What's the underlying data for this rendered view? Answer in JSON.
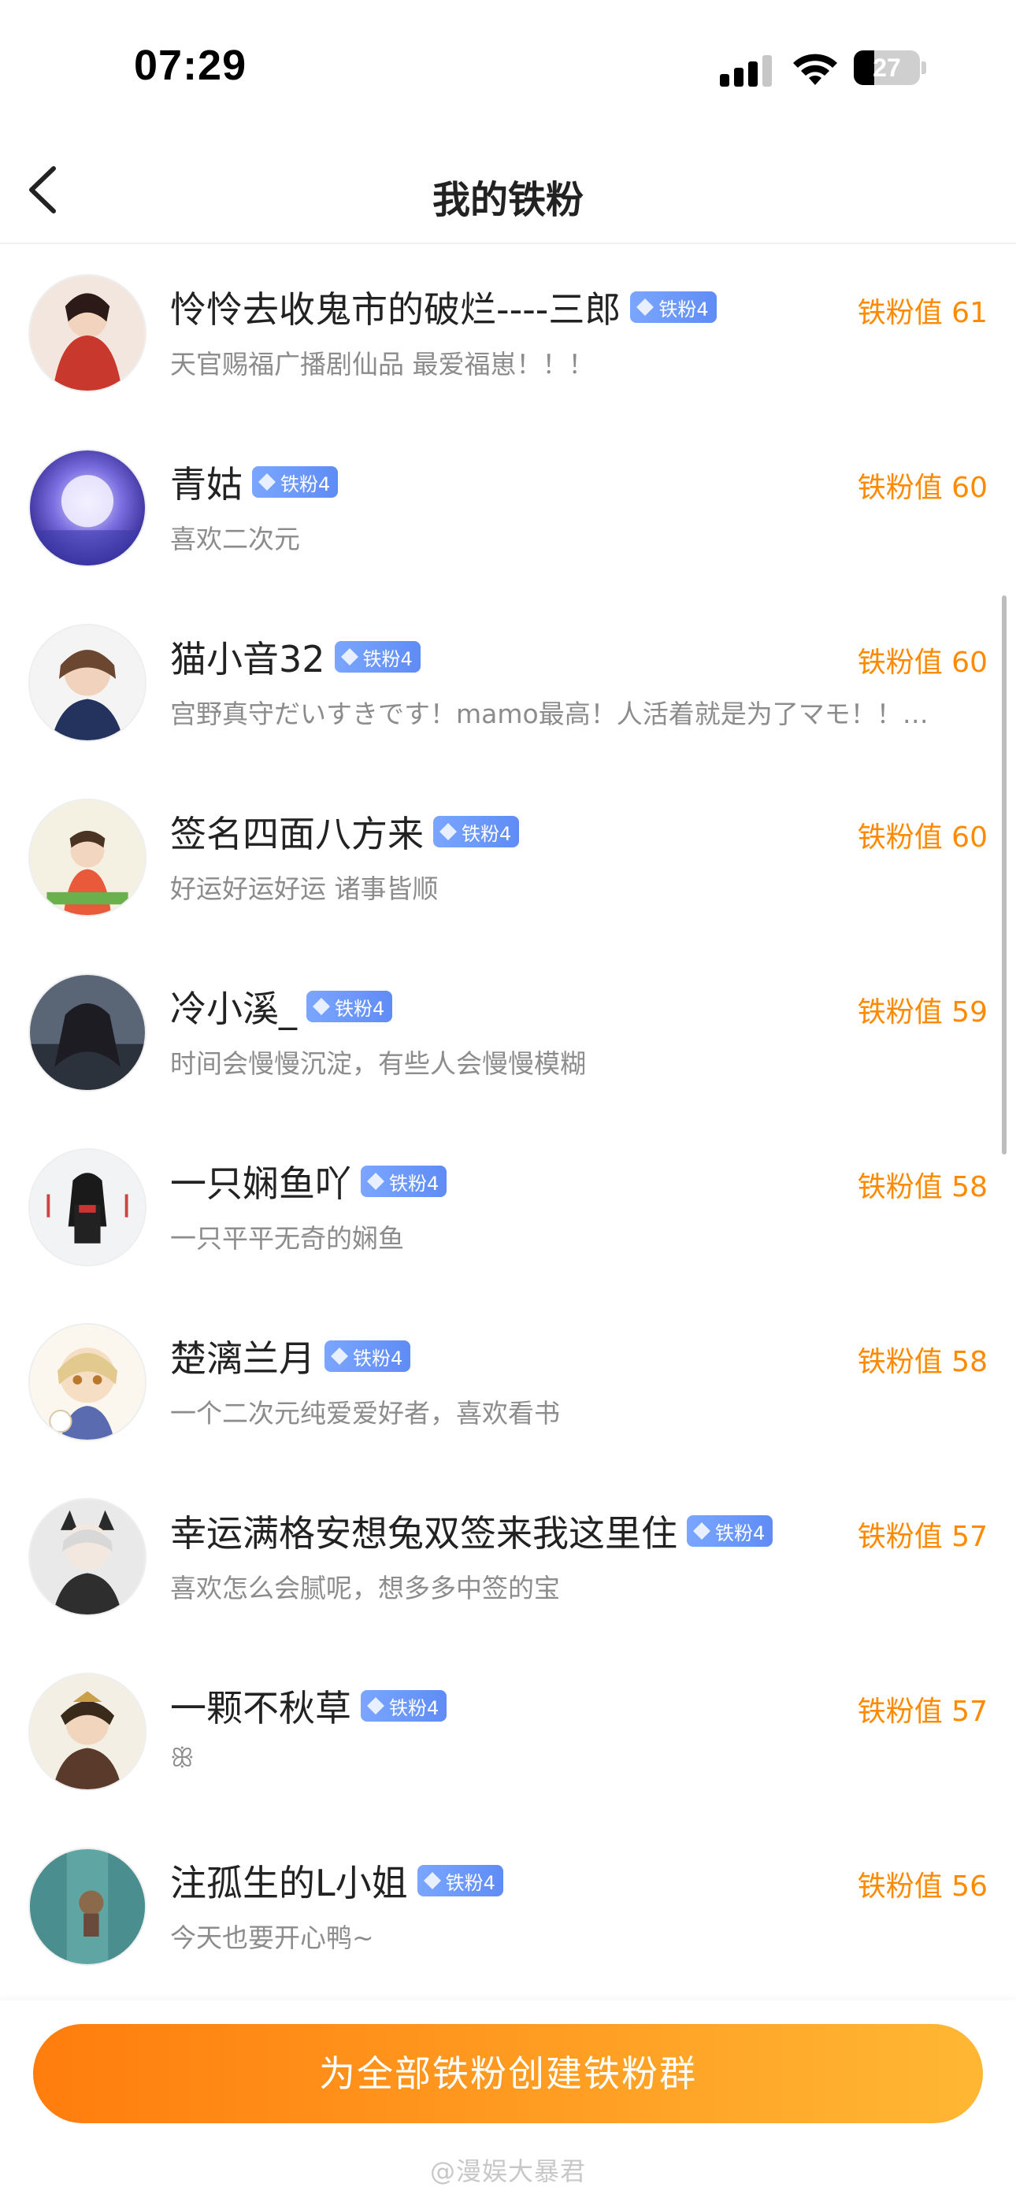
{
  "status": {
    "time": "07:29",
    "battery": "27"
  },
  "nav": {
    "title": "我的铁粉"
  },
  "badge_label": "铁粉4",
  "score_prefix": "铁粉值",
  "fans": [
    {
      "name": "怜怜去收鬼市的破烂----三郎",
      "desc": "天官赐福广播剧仙品 最爱福崽！！！",
      "score": "铁粉值 61",
      "verified": false,
      "avatar_color": "#c8382d"
    },
    {
      "name": "青姑",
      "desc": "喜欢二次元",
      "score": "铁粉值 60",
      "verified": false,
      "avatar_color": "#5a54c8"
    },
    {
      "name": "猫小音32",
      "desc": "宫野真守だいすきです！mamo最高！人活着就是为了マモ！！…",
      "score": "铁粉值 60",
      "verified": false,
      "avatar_color": "#2a3a66"
    },
    {
      "name": "签名四面八方来",
      "desc": "好运好运好运 诸事皆顺",
      "score": "铁粉值 60",
      "verified": false,
      "avatar_color": "#e8e2c8"
    },
    {
      "name": "冷小溪_",
      "desc": "时间会慢慢沉淀，有些人会慢慢模糊",
      "score": "铁粉值 59",
      "verified": true,
      "avatar_color": "#3a4452"
    },
    {
      "name": "一只娴鱼吖",
      "desc": "一只平平无奇的娴鱼",
      "score": "铁粉值 58",
      "verified": false,
      "avatar_color": "#f0f0f0"
    },
    {
      "name": "楚漓兰月",
      "desc": "一个二次元纯爱爱好者，喜欢看书",
      "score": "铁粉值 58",
      "verified": false,
      "avatar_color": "#e8d8a8"
    },
    {
      "name": "幸运满格安想兔双签来我这里住",
      "desc": "喜欢怎么会腻呢，想多多中签的宝",
      "score": "铁粉值 57",
      "verified": true,
      "avatar_color": "#9a9a9a"
    },
    {
      "name": "一颗不秋草",
      "desc": "ꕥ",
      "score": "铁粉值 57",
      "verified": true,
      "avatar_color": "#b89858"
    },
    {
      "name": "注孤生的L小姐",
      "desc": "今天也要开心鸭~",
      "score": "铁粉值 56",
      "verified": false,
      "avatar_color": "#5aa0a0"
    }
  ],
  "bottom": {
    "button_label": "为全部铁粉创建铁粉群",
    "watermark": "@漫娱大暴君"
  },
  "colors": {
    "accent": "#ff8a00",
    "badge": "#6a96f8",
    "verified": "#ffb11a"
  }
}
